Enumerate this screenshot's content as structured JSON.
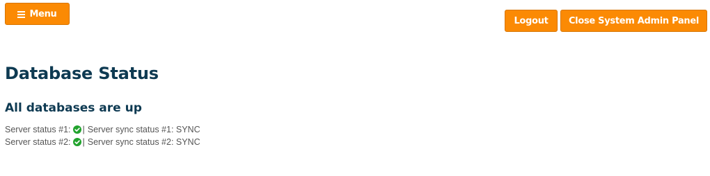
{
  "header": {
    "menu_label": "Menu",
    "logout_label": "Logout",
    "close_label": "Close System Admin Panel"
  },
  "main": {
    "title": "Database Status",
    "summary": "All databases are up",
    "servers": [
      {
        "status_label": "Server status #1:",
        "status_icon": "check-circle-icon",
        "separator": "|",
        "sync_label": "Server sync status #1: SYNC"
      },
      {
        "status_label": "Server status #2:",
        "status_icon": "check-circle-icon",
        "separator": "|",
        "sync_label": "Server sync status #2: SYNC"
      }
    ]
  },
  "colors": {
    "accent": "#fb8a04",
    "heading": "#0e3a52",
    "ok": "#22a32e",
    "text": "#555555"
  }
}
